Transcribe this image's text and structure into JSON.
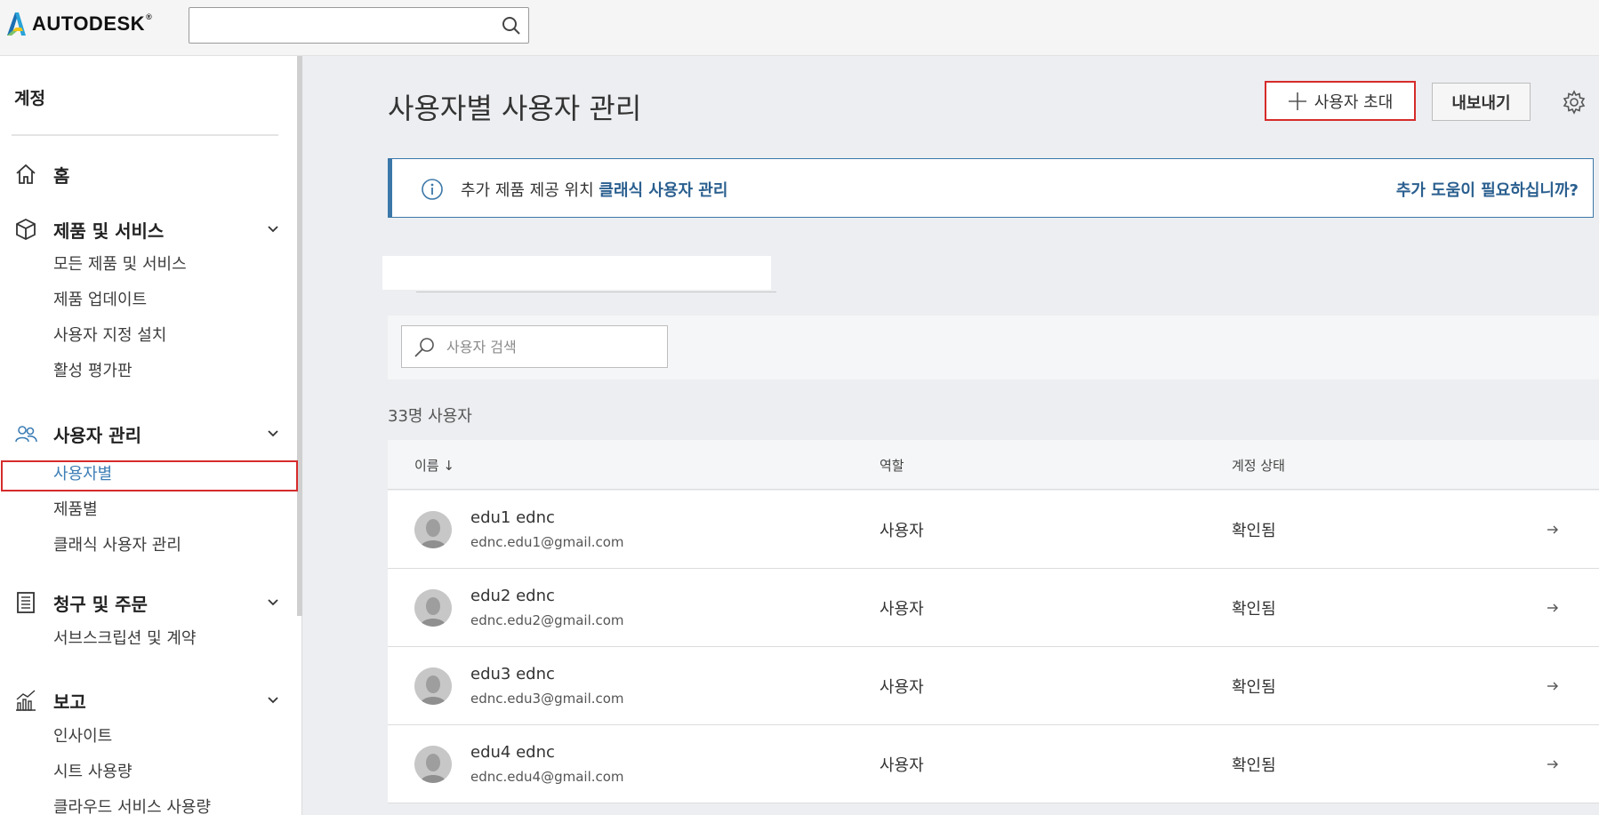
{
  "header": {
    "logo_text": "AUTODESK",
    "logo_mark": "®",
    "search": {
      "value": "",
      "placeholder": ""
    }
  },
  "sidebar": {
    "title": "계정",
    "sections": [
      {
        "label": "홈",
        "icon": "home-icon",
        "items": []
      },
      {
        "label": "제품 및 서비스",
        "icon": "box-icon",
        "items": [
          "모든 제품 및 서비스",
          "제품 업데이트",
          "사용자 지정 설치",
          "활성 평가판"
        ]
      },
      {
        "label": "사용자 관리",
        "icon": "users-icon",
        "items": [
          "사용자별",
          "제품별",
          "클래식 사용자 관리"
        ],
        "active_item": "사용자별"
      },
      {
        "label": "청구 및 주문",
        "icon": "receipt-icon",
        "items": [
          "서브스크립션 및 계약"
        ]
      },
      {
        "label": "보고",
        "icon": "chart-icon",
        "items": [
          "인사이트",
          "시트 사용량",
          "클라우드 서비스 사용량"
        ]
      }
    ]
  },
  "main": {
    "title": "사용자별 사용자 관리",
    "invite_label": "사용자 초대",
    "export_label": "내보내기",
    "banner": {
      "text": "추가 제품 제공 위치",
      "link": "클래식 사용자 관리",
      "help": "추가 도움이 필요하십니까?"
    },
    "user_search": {
      "placeholder": "사용자 검색",
      "value": ""
    },
    "count_text": "33명 사용자",
    "columns": {
      "name": "이름 ↓",
      "role": "역할",
      "status": "계정 상태"
    },
    "users": [
      {
        "name": "edu1 ednc",
        "email": "ednc.edu1@gmail.com",
        "role": "사용자",
        "status": "확인됨"
      },
      {
        "name": "edu2 ednc",
        "email": "ednc.edu2@gmail.com",
        "role": "사용자",
        "status": "확인됨"
      },
      {
        "name": "edu3 ednc",
        "email": "ednc.edu3@gmail.com",
        "role": "사용자",
        "status": "확인됨"
      },
      {
        "name": "edu4 ednc",
        "email": "ednc.edu4@gmail.com",
        "role": "사용자",
        "status": "확인됨"
      }
    ]
  },
  "colors": {
    "accent": "#3b77a8",
    "link": "#2a5f8f",
    "highlight": "#d62b2b",
    "active_nav": "#3d7eb5"
  }
}
